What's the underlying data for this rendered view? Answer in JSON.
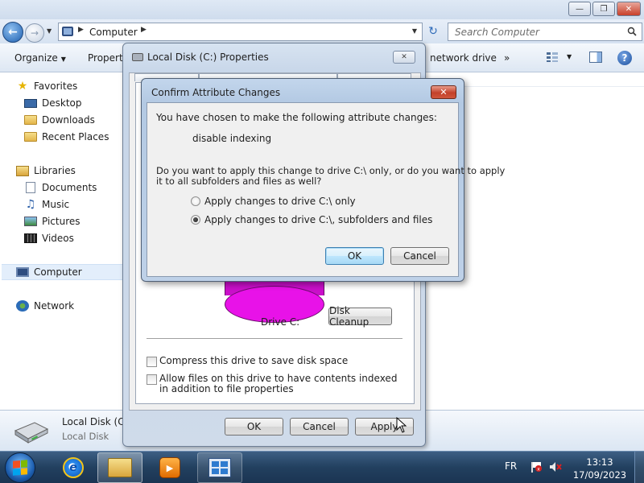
{
  "explorer": {
    "address": {
      "segment": "Computer"
    },
    "search": {
      "placeholder": "Search Computer"
    },
    "toolbar": {
      "organize": "Organize",
      "properties": "Properti",
      "map_network": "network drive",
      "more": "»"
    },
    "nav": {
      "favorites": "Favorites",
      "desktop": "Desktop",
      "downloads": "Downloads",
      "recent_places": "Recent Places",
      "libraries": "Libraries",
      "documents": "Documents",
      "music": "Music",
      "pictures": "Pictures",
      "videos": "Videos",
      "computer": "Computer",
      "network": "Network"
    },
    "details": {
      "name": "Local Disk (C",
      "type": "Local Disk"
    }
  },
  "properties_dialog": {
    "title": "Local Disk (C:) Properties",
    "drive_label": "Drive C:",
    "disk_cleanup": "Disk Cleanup",
    "compress_label": "Compress this drive to save disk space",
    "index_label": "Allow files on this drive to have contents indexed in addition to file properties",
    "compress_checked": false,
    "index_checked": false,
    "ok": "OK",
    "cancel": "Cancel",
    "apply": "Apply"
  },
  "confirm_dialog": {
    "title": "Confirm Attribute Changes",
    "intro": "You have chosen to make the following attribute changes:",
    "change": "disable indexing",
    "question_line1": "Do you want to apply this change to drive C:\\ only, or do you want to apply",
    "question_line2": "it to all subfolders and files as well?",
    "option_drive_only": "Apply changes to drive C:\\ only",
    "option_all": "Apply changes to drive C:\\, subfolders and files",
    "selected_option": "option_all",
    "ok": "OK",
    "cancel": "Cancel"
  },
  "taskbar": {
    "language": "FR",
    "time": "13:13",
    "date": "17/09/2023"
  },
  "icons": {
    "back": "back-arrow-icon",
    "forward": "forward-arrow-icon",
    "refresh": "refresh-icon",
    "search": "magnifier-icon",
    "help": "help-icon",
    "close": "close-icon"
  },
  "colors": {
    "drive_pie_used": "#e812e8",
    "dialog_frame": "#bed1e8",
    "close_button": "#c3412a",
    "taskbar": "#22405f"
  }
}
